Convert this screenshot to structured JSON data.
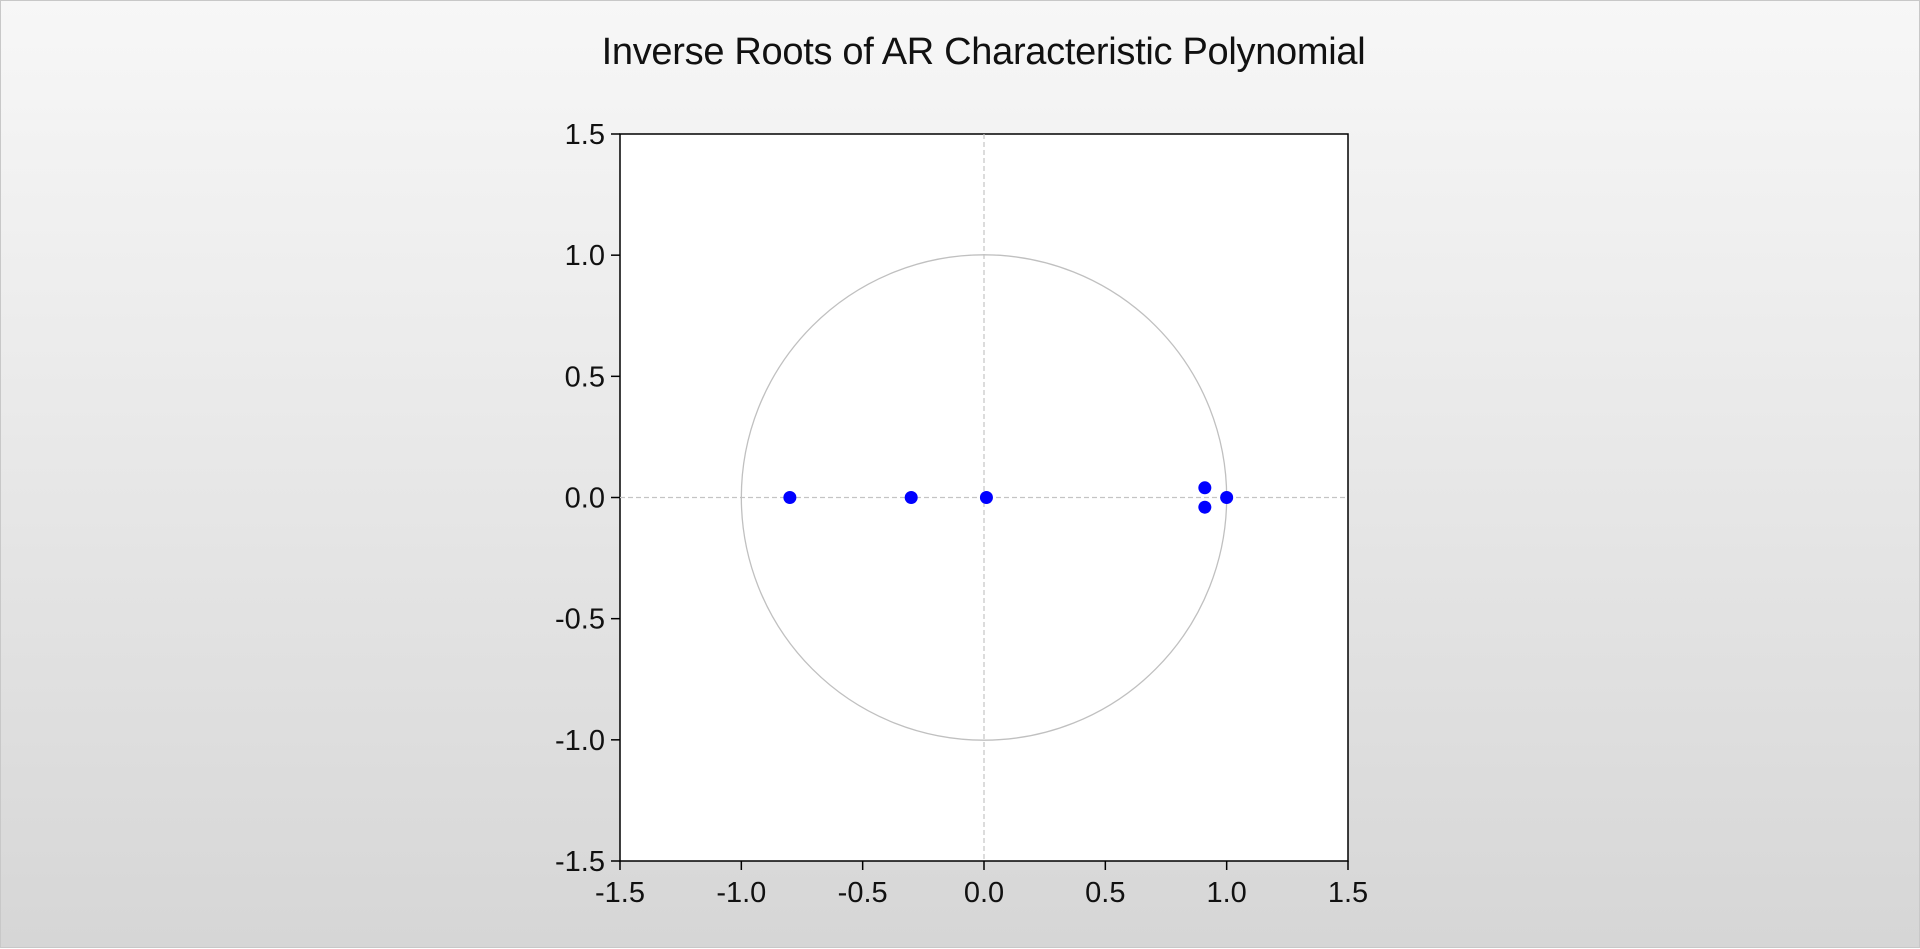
{
  "chart_data": {
    "type": "scatter",
    "title": "Inverse Roots of AR Characteristic Polynomial",
    "xlabel": "",
    "ylabel": "",
    "xlim": [
      -1.5,
      1.5
    ],
    "ylim": [
      -1.5,
      1.5
    ],
    "x_ticks": [
      "-1.5",
      "-1.0",
      "-0.5",
      "0.0",
      "0.5",
      "1.0",
      "1.5"
    ],
    "y_ticks": [
      "1.5",
      "1.0",
      "0.5",
      "0.0",
      "-0.5",
      "-1.0",
      "-1.5"
    ],
    "unit_circle": true,
    "zero_lines": true,
    "grid": false,
    "marker_color": "#0000ff",
    "circle_color": "#c0c0c0",
    "points": [
      {
        "x": -0.8,
        "y": 0.0
      },
      {
        "x": -0.3,
        "y": 0.0
      },
      {
        "x": 0.01,
        "y": 0.0
      },
      {
        "x": 0.91,
        "y": 0.04
      },
      {
        "x": 0.91,
        "y": -0.04
      },
      {
        "x": 1.0,
        "y": 0.0
      }
    ]
  }
}
